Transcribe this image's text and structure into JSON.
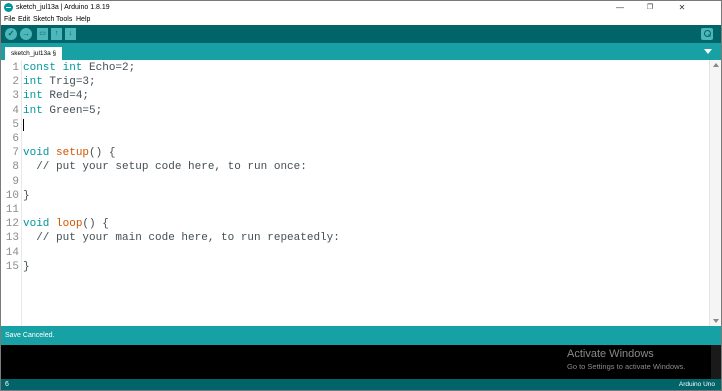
{
  "window": {
    "title": "sketch_jul13a | Arduino 1.8.19",
    "minimize": "—",
    "restore": "❐",
    "close": "✕"
  },
  "menu": [
    "File",
    "Edit",
    "Sketch",
    "Tools",
    "Help"
  ],
  "toolbar": {
    "verify_icon": "✓",
    "upload_icon": "→",
    "new_icon": "▭",
    "open_icon": "↑",
    "save_icon": "↓"
  },
  "tab": {
    "label": "sketch_jul13a §"
  },
  "editor": {
    "lines": [
      {
        "n": "1",
        "parts": [
          {
            "t": "const ",
            "c": "kw"
          },
          {
            "t": "int",
            "c": "kw"
          },
          {
            "t": " Echo=2;",
            "c": "plain"
          }
        ]
      },
      {
        "n": "2",
        "parts": [
          {
            "t": "int",
            "c": "kw"
          },
          {
            "t": " Trig=3;",
            "c": "plain"
          }
        ]
      },
      {
        "n": "3",
        "parts": [
          {
            "t": "int",
            "c": "kw"
          },
          {
            "t": " Red=4;",
            "c": "plain"
          }
        ]
      },
      {
        "n": "4",
        "parts": [
          {
            "t": "int",
            "c": "kw"
          },
          {
            "t": " Green=5;",
            "c": "plain"
          }
        ]
      },
      {
        "n": "5",
        "parts": []
      },
      {
        "n": "6",
        "parts": []
      },
      {
        "n": "7",
        "parts": [
          {
            "t": "void",
            "c": "kw"
          },
          {
            "t": " ",
            "c": "plain"
          },
          {
            "t": "setup",
            "c": "fn"
          },
          {
            "t": "() {",
            "c": "plain"
          }
        ]
      },
      {
        "n": "8",
        "parts": [
          {
            "t": "  // put your setup code here, to run once:",
            "c": "cmt"
          }
        ]
      },
      {
        "n": "9",
        "parts": []
      },
      {
        "n": "10",
        "parts": [
          {
            "t": "}",
            "c": "plain"
          }
        ]
      },
      {
        "n": "11",
        "parts": []
      },
      {
        "n": "12",
        "parts": [
          {
            "t": "void",
            "c": "kw"
          },
          {
            "t": " ",
            "c": "plain"
          },
          {
            "t": "loop",
            "c": "fn"
          },
          {
            "t": "() {",
            "c": "plain"
          }
        ]
      },
      {
        "n": "13",
        "parts": [
          {
            "t": "  // put your main code here, to run repeatedly:",
            "c": "cmt"
          }
        ]
      },
      {
        "n": "14",
        "parts": []
      },
      {
        "n": "15",
        "parts": [
          {
            "t": "}",
            "c": "plain"
          }
        ]
      }
    ]
  },
  "status": {
    "message": "Save Canceled."
  },
  "watermark": {
    "title": "Activate Windows",
    "subtitle": "Go to Settings to activate Windows."
  },
  "footer": {
    "line": "6",
    "board": "Arduino Uno"
  },
  "colors": {
    "teal_dark": "#006468",
    "teal": "#17a1a5",
    "keyword": "#00979c",
    "function": "#d35400"
  }
}
